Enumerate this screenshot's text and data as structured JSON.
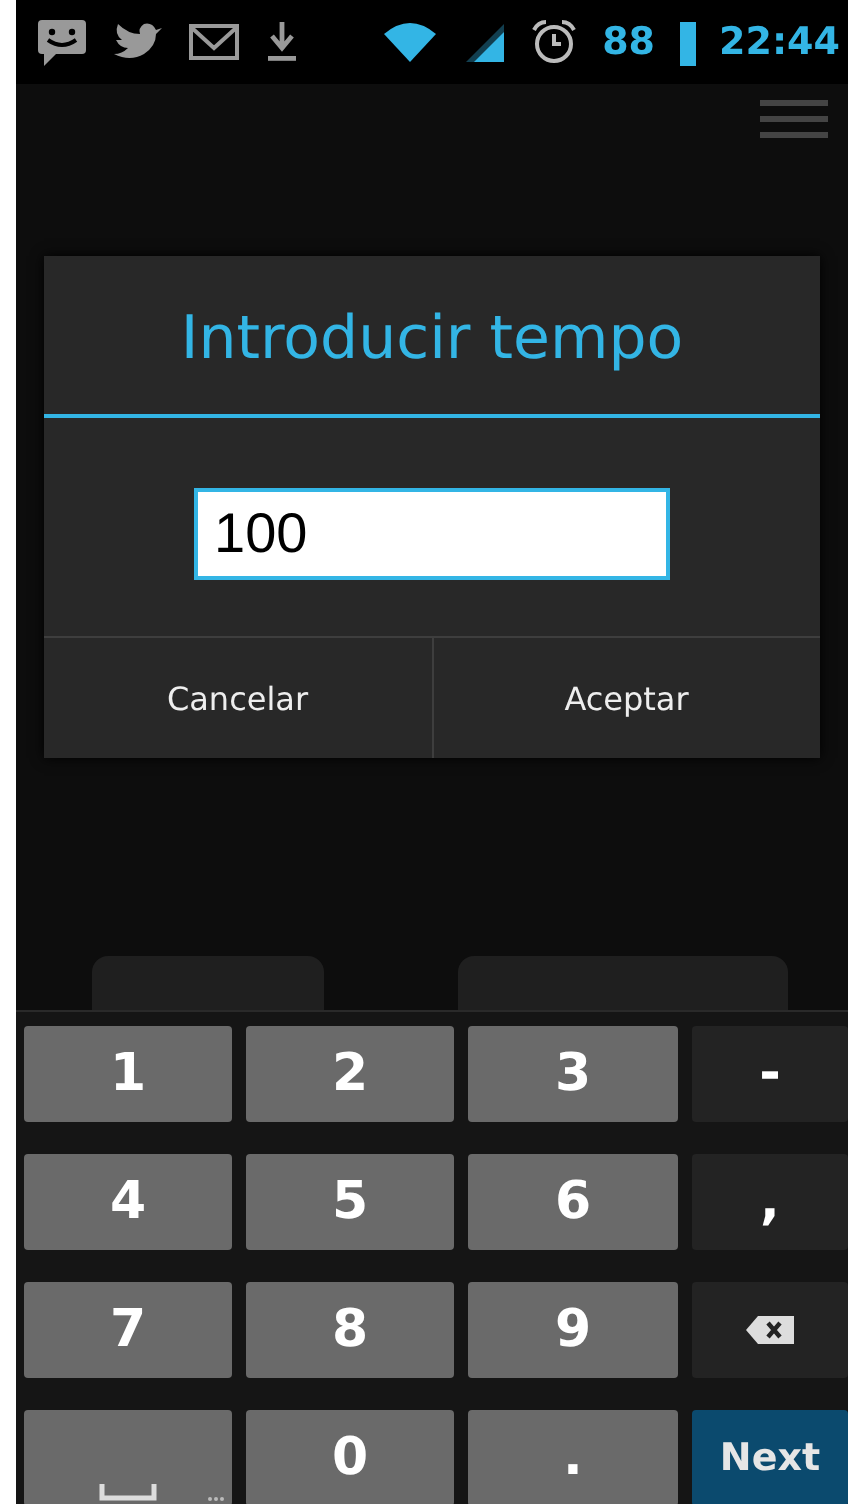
{
  "status_bar": {
    "battery": "88",
    "time": "22:44"
  },
  "dialog": {
    "title": "Introducir tempo",
    "input": {
      "value": "100"
    },
    "buttons": [
      "Cancelar",
      "Aceptar"
    ]
  },
  "keyboard": {
    "rows": [
      [
        {
          "kind": "key",
          "label": "1"
        },
        {
          "kind": "key",
          "label": "2"
        },
        {
          "kind": "key",
          "label": "3"
        },
        {
          "kind": "function",
          "label": "-"
        }
      ],
      [
        {
          "kind": "key",
          "label": "4"
        },
        {
          "kind": "key",
          "label": "5"
        },
        {
          "kind": "key",
          "label": "6"
        },
        {
          "kind": "function",
          "label": ","
        }
      ],
      [
        {
          "kind": "key",
          "label": "7"
        },
        {
          "kind": "key",
          "label": "8"
        },
        {
          "kind": "key",
          "label": "9"
        },
        {
          "kind": "backspace"
        }
      ],
      [
        {
          "kind": "space"
        },
        {
          "kind": "key",
          "label": "0"
        },
        {
          "kind": "key",
          "label": "."
        },
        {
          "kind": "action",
          "label": "Next"
        }
      ]
    ]
  }
}
